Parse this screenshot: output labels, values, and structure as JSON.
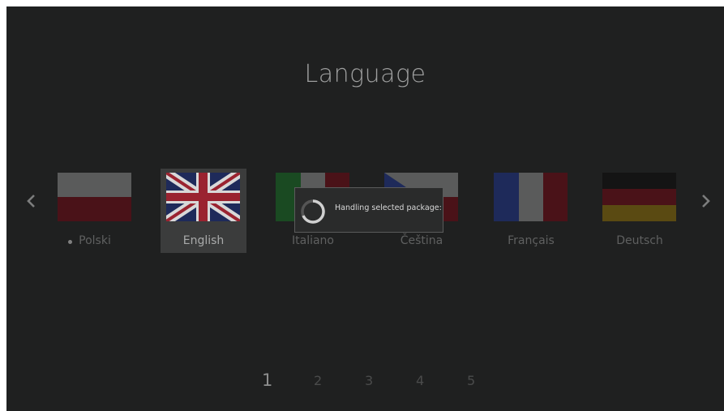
{
  "title": "Language",
  "nav": {
    "prev_icon": "chevron-left-icon",
    "next_icon": "chevron-right-icon"
  },
  "languages": [
    {
      "label": "Polski",
      "flag": "poland-flag-icon",
      "current": true
    },
    {
      "label": "English",
      "flag": "uk-flag-icon",
      "selected": true
    },
    {
      "label": "Italiano",
      "flag": "italy-flag-icon"
    },
    {
      "label": "Čeština",
      "flag": "czech-flag-icon"
    },
    {
      "label": "Français",
      "flag": "france-flag-icon"
    },
    {
      "label": "Deutsch",
      "flag": "germany-flag-icon"
    }
  ],
  "pagination": {
    "pages": [
      "1",
      "2",
      "3",
      "4",
      "5"
    ],
    "active": "1"
  },
  "dialog": {
    "message": "Handling selected package:",
    "icon": "loading-spinner-icon"
  },
  "colors": {
    "background": "#1f2020",
    "selected_tile": "#3b3c3c",
    "dialog_bg": "#2a2b2b",
    "dialog_border": "#5a5b5b"
  }
}
